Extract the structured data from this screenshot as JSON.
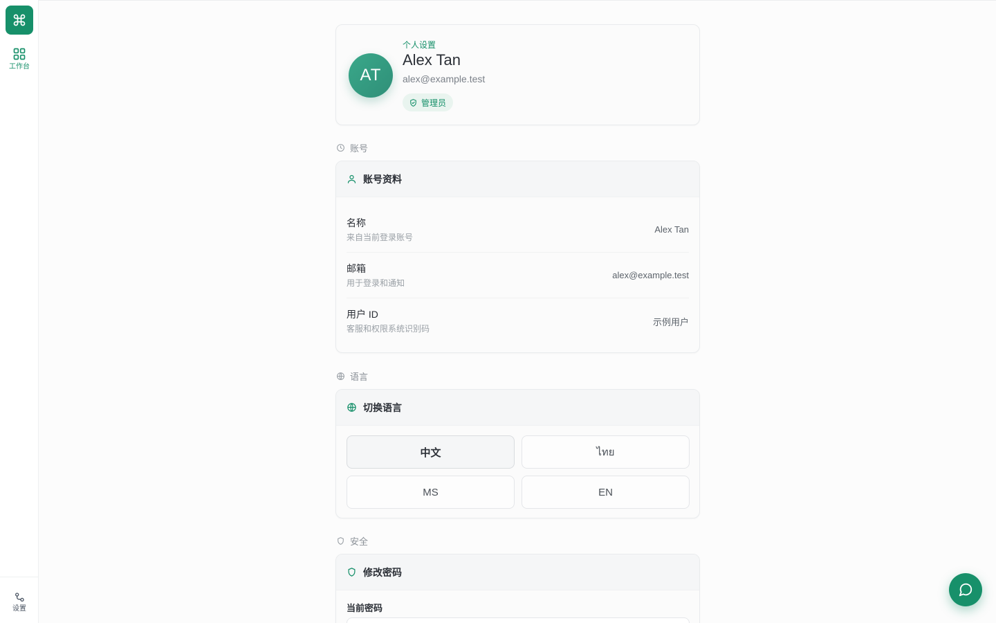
{
  "sidebar": {
    "logo_icon": "command-icon",
    "workbench_label": "工作台",
    "settings_label": "设置"
  },
  "profile": {
    "eyebrow": "个人设置",
    "name": "Alex Tan",
    "email": "alex@example.test",
    "initials": "AT",
    "role_badge": "管理员"
  },
  "sections": {
    "account": {
      "label": "账号",
      "card_title": "账号资料",
      "rows": [
        {
          "title": "名称",
          "subtitle": "来自当前登录账号",
          "value": "Alex Tan"
        },
        {
          "title": "邮箱",
          "subtitle": "用于登录和通知",
          "value": "alex@example.test"
        },
        {
          "title": "用户 ID",
          "subtitle": "客服和权限系统识别码",
          "value": "示例用户"
        }
      ]
    },
    "language": {
      "label": "语言",
      "card_title": "切换语言",
      "options": [
        "中文",
        "ไทย",
        "MS",
        "EN"
      ],
      "selected": "中文"
    },
    "security": {
      "label": "安全",
      "card_title": "修改密码",
      "current_password_label": "当前密码"
    }
  },
  "colors": {
    "accent": "#17906a",
    "accent_soft": "#e9f4ef"
  }
}
